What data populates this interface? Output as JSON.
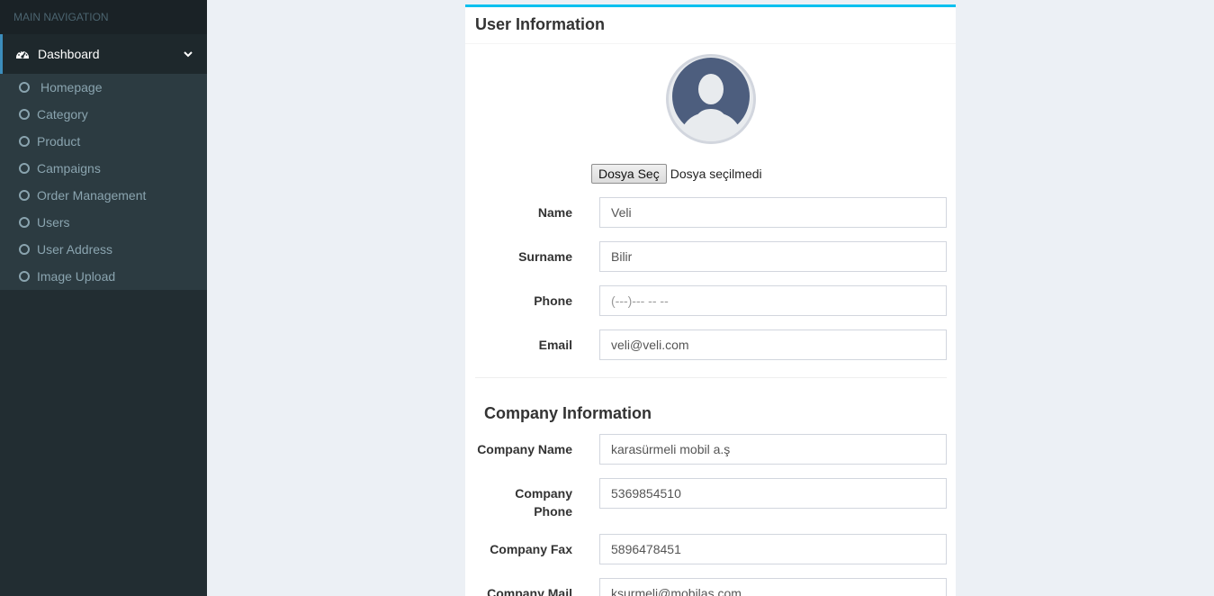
{
  "sidebar": {
    "header": "MAIN NAVIGATION",
    "active": {
      "label": "Dashboard",
      "icon": "dashboard-icon"
    },
    "items": [
      {
        "label": "Homepage"
      },
      {
        "label": "Category"
      },
      {
        "label": "Product"
      },
      {
        "label": "Campaigns"
      },
      {
        "label": "Order Management"
      },
      {
        "label": "Users"
      },
      {
        "label": "User Address"
      },
      {
        "label": "Image Upload"
      }
    ]
  },
  "card": {
    "title": "User Information",
    "file_button": "Dosya Seç",
    "file_status": "Dosya seçilmedi",
    "fields": {
      "name": {
        "label": "Name",
        "value": "Veli"
      },
      "surname": {
        "label": "Surname",
        "value": "Bilir"
      },
      "phone": {
        "label": "Phone",
        "value": "",
        "placeholder": "(---)--- -- --"
      },
      "email": {
        "label": "Email",
        "value": "veli@veli.com"
      }
    },
    "company_title": "Company Information",
    "company": {
      "name": {
        "label": "Company Name",
        "value": "karasürmeli mobil a.ş"
      },
      "phone": {
        "label": "Company Phone",
        "value": "5369854510"
      },
      "fax": {
        "label": "Company Fax",
        "value": "5896478451"
      },
      "mail": {
        "label": "Company Mail",
        "value": "ksurmeli@mobilas.com"
      }
    }
  },
  "colors": {
    "sidebar_bg": "#222d32",
    "accent": "#3c8dbc",
    "card_border": "#00c0ef",
    "page_bg": "#ecf0f5"
  }
}
